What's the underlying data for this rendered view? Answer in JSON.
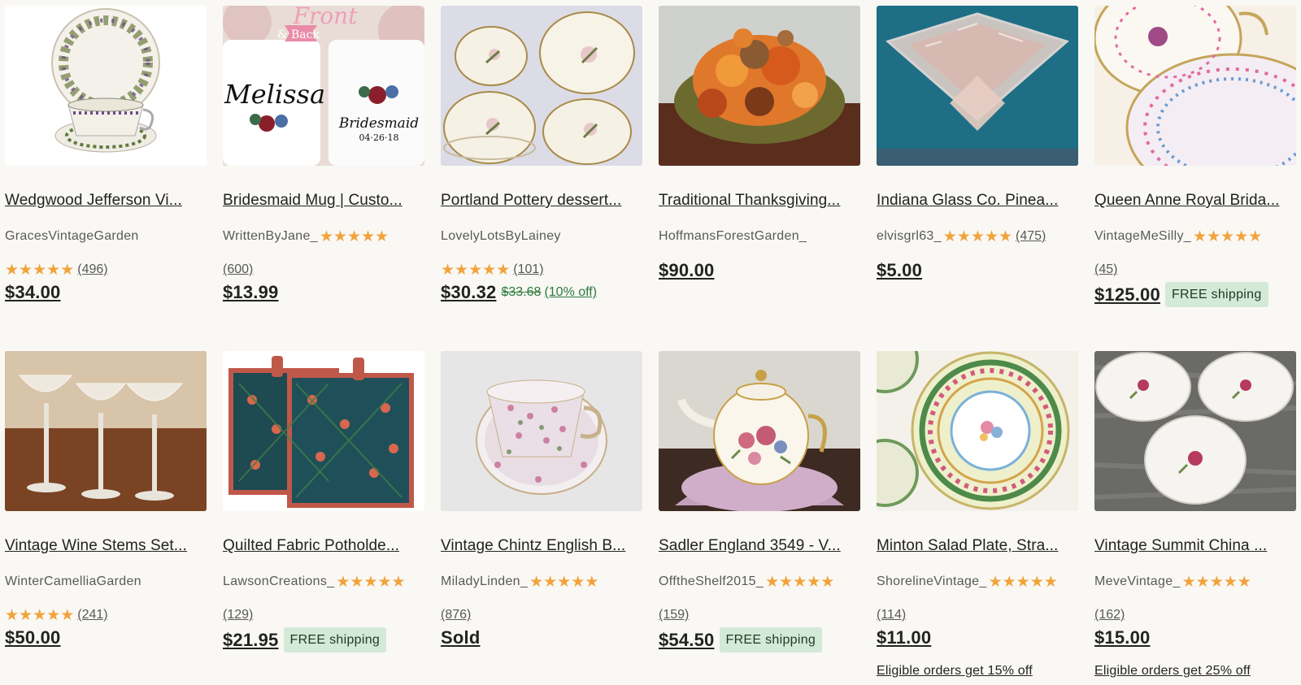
{
  "colors": {
    "star": "#f1a33c",
    "sale_green": "#2a7a3a",
    "badge_bg": "#d4e9d7",
    "page_bg": "#f9f8f4"
  },
  "star_icon": "★",
  "listings": [
    {
      "title": "Wedgwood Jefferson Vi...",
      "shop": "GracesVintageGarden",
      "rating": 5,
      "reviews": "(496)",
      "reviews_inline": false,
      "price": "$34.00"
    },
    {
      "title": "Bridesmaid Mug | Custo...",
      "shop": "WrittenByJane_",
      "rating": 5,
      "reviews": "(600)",
      "reviews_inline": false,
      "stars_inline": true,
      "price": "$13.99"
    },
    {
      "title": "Portland Pottery dessert...",
      "shop": "LovelyLotsByLainey",
      "rating": 5,
      "reviews": "(101)",
      "price": "$30.32",
      "original_price": "$33.68",
      "discount": "(10% off)"
    },
    {
      "title": "Traditional Thanksgiving...",
      "shop": "HoffmansForestGarden_",
      "price": "$90.00",
      "price_high": true
    },
    {
      "title": "Indiana Glass Co. Pinea...",
      "shop": "elvisgrl63_",
      "rating": 5,
      "reviews": "(475)",
      "stars_inline": true,
      "reviews_inline": true,
      "price": "$5.00",
      "price_high": true
    },
    {
      "title": "Queen Anne Royal Brida...",
      "shop": "VintageMeSilly_",
      "rating": 5,
      "reviews": "(45)",
      "stars_inline": true,
      "price": "$125.00",
      "badge": "FREE shipping"
    },
    {
      "title": "Vintage Wine Stems Set...",
      "shop": "WinterCamelliaGarden",
      "rating": 5,
      "reviews": "(241)",
      "price": "$50.00"
    },
    {
      "title": "Quilted Fabric Potholde...",
      "shop": "LawsonCreations_",
      "rating": 5,
      "reviews": "(129)",
      "stars_inline": true,
      "price": "$21.95",
      "badge": "FREE shipping"
    },
    {
      "title": "Vintage Chintz English B...",
      "shop": "MiladyLinden_",
      "rating": 5,
      "reviews": "(876)",
      "stars_inline": true,
      "price": "Sold"
    },
    {
      "title": "Sadler England 3549 - V...",
      "shop": "OfftheShelf2015_",
      "rating": 5,
      "reviews": "(159)",
      "stars_inline": true,
      "price": "$54.50",
      "badge": "FREE shipping"
    },
    {
      "title": "Minton Salad Plate, Stra...",
      "shop": "ShorelineVintage_",
      "rating": 5,
      "reviews": "(114)",
      "stars_inline": true,
      "price": "$11.00",
      "promo": "Eligible orders get 15% off"
    },
    {
      "title": "Vintage Summit China ...",
      "shop": "MeveVintage_",
      "rating": 5,
      "reviews": "(162)",
      "stars_inline": true,
      "price": "$15.00",
      "promo": "Eligible orders get 25% off"
    }
  ]
}
